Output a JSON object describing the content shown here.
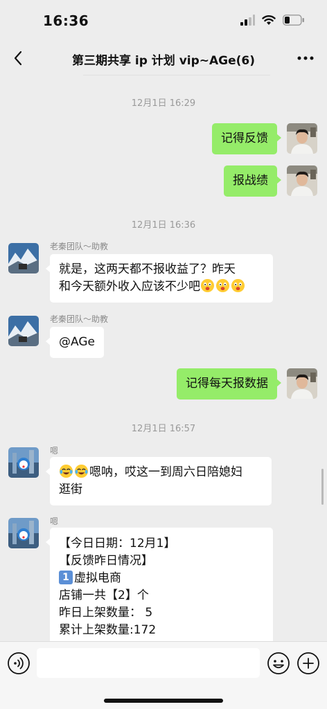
{
  "status": {
    "time": "16:36"
  },
  "header": {
    "title": "第三期共享 ip 计划 vip~AGe(6)"
  },
  "messages": {
    "ts1": "12月1日 16:29",
    "m1": "记得反馈",
    "m2": "报战绩",
    "ts2": "12月1日 16:36",
    "sender_assistant": "老秦团队～助教",
    "m3_line1": "就是，这两天都不报收益了？昨天",
    "m3_line2": "和今天额外收入应该不少吧",
    "m4": "@AGe",
    "m5": "记得每天报数据",
    "ts3": "12月1日 16:57",
    "sender_user": "嗯",
    "m6_line1": "嗯呐，哎这一到周六日陪媳妇",
    "m6_line2": "逛街",
    "m7_line1": "【今日日期：12月1】",
    "m7_line2": "【反馈昨日情况】",
    "m7_line3_badge": "1",
    "m7_line3": "虚拟电商",
    "m7_line4": "店铺一共【2】个",
    "m7_line5": "昨日上架数量：  5",
    "m7_line6": "累计上架数量:172"
  },
  "input": {
    "placeholder": ""
  },
  "icons": {
    "back": "chevron-left-icon",
    "more": "more-dots-icon",
    "voice": "voice-icon",
    "emoji": "emoji-icon",
    "plus": "plus-icon",
    "emoji_face": "surprised-face-emoji",
    "emoji_laugh": "laugh-crying-emoji"
  },
  "colors": {
    "bubble_out": "#95ec69",
    "bubble_in": "#ffffff",
    "background": "#ededed"
  }
}
